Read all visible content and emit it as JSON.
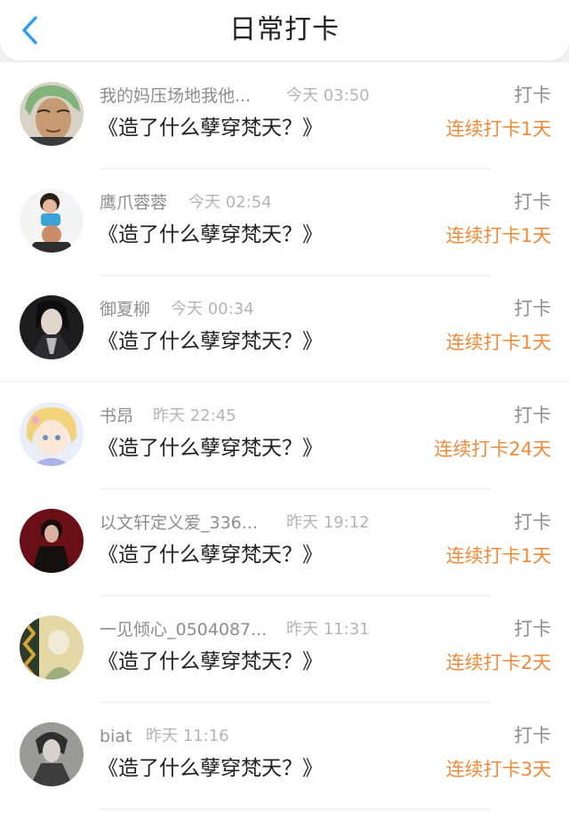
{
  "header": {
    "title": "日常打卡",
    "back_icon": "chevron-left-icon",
    "accent": "#2a9df4"
  },
  "colors": {
    "streak": "#ee8a3b",
    "meta": "#8d8d8d",
    "time": "#b4b4b4"
  },
  "items": [
    {
      "username": "我的妈压场地我他...",
      "time": "今天 03:50",
      "book": "《造了什么孽穿梵天？》",
      "action": "打卡",
      "streak": "连续打卡1天",
      "avatar": "avatar-green-hair"
    },
    {
      "username": "鹰爪蓉蓉",
      "time": "今天 02:54",
      "book": "《造了什么孽穿梵天？》",
      "action": "打卡",
      "streak": "连续打卡1天",
      "avatar": "avatar-child-photo"
    },
    {
      "username": "御夏柳",
      "time": "今天 00:34",
      "book": "《造了什么孽穿梵天？》",
      "action": "打卡",
      "streak": "连续打卡1天",
      "avatar": "avatar-dark-character"
    },
    {
      "username": "书昂",
      "time": "昨天 22:45",
      "book": "《造了什么孽穿梵天？》",
      "action": "打卡",
      "streak": "连续打卡24天",
      "avatar": "avatar-anime-girl"
    },
    {
      "username": "以文轩定义爱_336...",
      "time": "昨天 19:12",
      "book": "《造了什么孽穿梵天？》",
      "action": "打卡",
      "streak": "连续打卡1天",
      "avatar": "avatar-red-portrait"
    },
    {
      "username": "一见倾心_0504087...",
      "time": "昨天 11:31",
      "book": "《造了什么孽穿梵天？》",
      "action": "打卡",
      "streak": "连续打卡2天",
      "avatar": "avatar-yellow-art"
    },
    {
      "username": "biat",
      "time": "昨天 11:16",
      "book": "《造了什么孽穿梵天？》",
      "action": "打卡",
      "streak": "连续打卡3天",
      "avatar": "avatar-grey-figure"
    }
  ]
}
